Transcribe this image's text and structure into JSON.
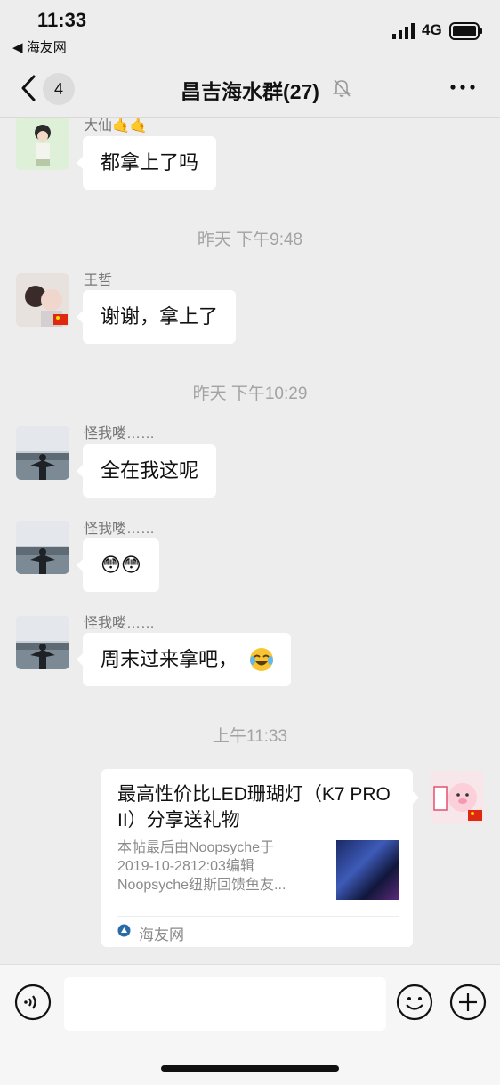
{
  "status_bar": {
    "time": "11:33",
    "back_app": "◀ 海友网",
    "network": "4G"
  },
  "nav": {
    "unread_count": "4",
    "title": "昌吉海水群(27)"
  },
  "messages": [
    {
      "sender": "大仙🤙🤙",
      "text": "都拿上了吗"
    },
    {
      "timestamp": "昨天 下午9:48"
    },
    {
      "sender": "王哲",
      "text": "谢谢，拿上了"
    },
    {
      "timestamp": "昨天 下午10:29"
    },
    {
      "sender": "怪我喽……",
      "text": "全在我这呢"
    },
    {
      "sender": "怪我喽……",
      "text": "😳😳"
    },
    {
      "sender": "怪我喽……",
      "text": "周末过来拿吧，"
    },
    {
      "timestamp": "上午11:33"
    }
  ],
  "link_card": {
    "title": "最高性价比LED珊瑚灯（K7 PRO II）分享送礼物",
    "description": "本帖最后由Noopsyche于\n2019-10-2812:03编辑\nNoopsyche纽斯回馈鱼友...",
    "source": "海友网"
  },
  "colors": {
    "background": "#ededed",
    "bubble": "#ffffff",
    "timestamp": "#a3a3a3"
  },
  "icons": [
    "back-chevron-icon",
    "mute-bell-icon",
    "more-icon",
    "voice-icon",
    "emoji-icon",
    "plus-icon"
  ]
}
